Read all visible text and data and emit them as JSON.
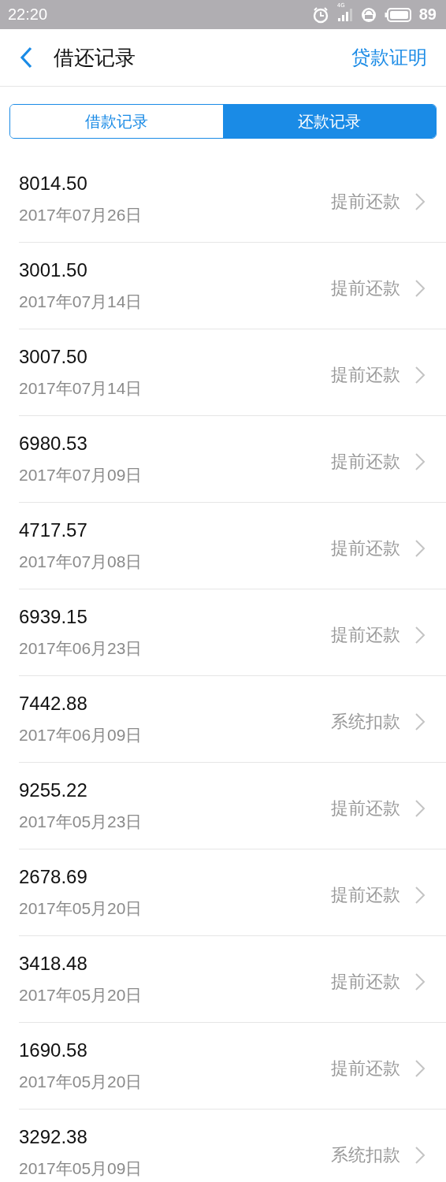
{
  "status_bar": {
    "time": "22:20",
    "network": "4G",
    "battery": "89"
  },
  "header": {
    "title": "借还记录",
    "action": "贷款证明"
  },
  "tabs": [
    {
      "label": "借款记录",
      "selected": false
    },
    {
      "label": "还款记录",
      "selected": true
    }
  ],
  "records": [
    {
      "amount": "8014.50",
      "date": "2017年07月26日",
      "type": "提前还款"
    },
    {
      "amount": "3001.50",
      "date": "2017年07月14日",
      "type": "提前还款"
    },
    {
      "amount": "3007.50",
      "date": "2017年07月14日",
      "type": "提前还款"
    },
    {
      "amount": "6980.53",
      "date": "2017年07月09日",
      "type": "提前还款"
    },
    {
      "amount": "4717.57",
      "date": "2017年07月08日",
      "type": "提前还款"
    },
    {
      "amount": "6939.15",
      "date": "2017年06月23日",
      "type": "提前还款"
    },
    {
      "amount": "7442.88",
      "date": "2017年06月09日",
      "type": "系统扣款"
    },
    {
      "amount": "9255.22",
      "date": "2017年05月23日",
      "type": "提前还款"
    },
    {
      "amount": "2678.69",
      "date": "2017年05月20日",
      "type": "提前还款"
    },
    {
      "amount": "3418.48",
      "date": "2017年05月20日",
      "type": "提前还款"
    },
    {
      "amount": "1690.58",
      "date": "2017年05月20日",
      "type": "提前还款"
    },
    {
      "amount": "3292.38",
      "date": "2017年05月09日",
      "type": "系统扣款"
    }
  ]
}
